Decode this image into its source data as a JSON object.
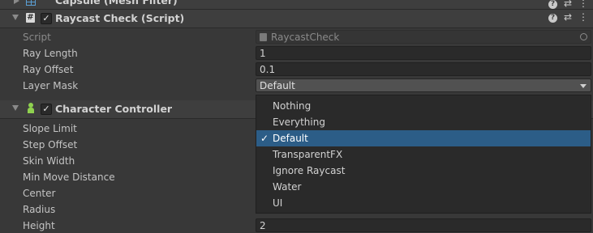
{
  "top_component": {
    "title": "Capsule (Mesh Filter)"
  },
  "raycast": {
    "title": "Raycast Check (Script)",
    "fields": {
      "script_label": "Script",
      "script_value": "RaycastCheck",
      "ray_length_label": "Ray Length",
      "ray_length_value": "1",
      "ray_offset_label": "Ray Offset",
      "ray_offset_value": "0.1",
      "layer_mask_label": "Layer Mask",
      "layer_mask_value": "Default"
    }
  },
  "character_controller": {
    "title": "Character Controller",
    "labels": {
      "slope_limit": "Slope Limit",
      "step_offset": "Step Offset",
      "skin_width": "Skin Width",
      "min_move_distance": "Min Move Distance",
      "center": "Center",
      "radius": "Radius",
      "height": "Height"
    },
    "height_value": "2"
  },
  "dropdown": {
    "items": [
      "Nothing",
      "Everything",
      "Default",
      "TransparentFX",
      "Ignore Raycast",
      "Water",
      "UI"
    ],
    "selected": "Default"
  },
  "colors": {
    "selection": "#2c5d87",
    "panel": "#383838",
    "header": "#3e3e3e"
  }
}
